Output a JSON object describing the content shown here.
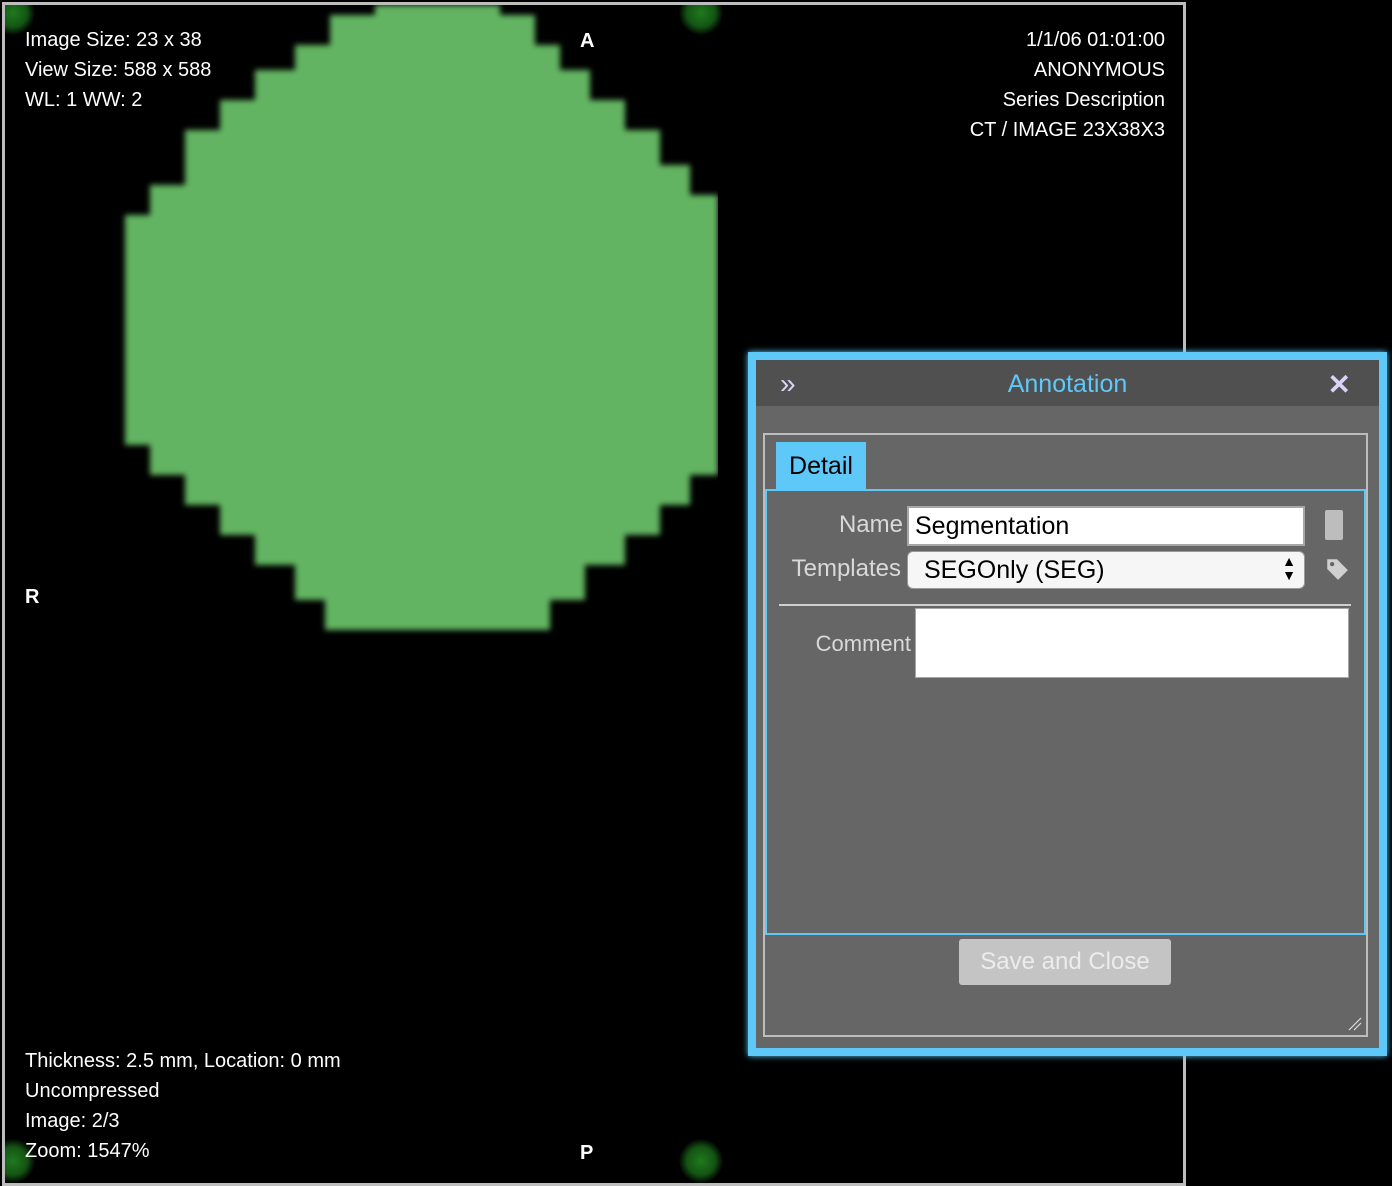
{
  "viewer": {
    "top_left": [
      "Image Size: 23 x 38",
      "View Size: 588 x 588",
      "WL: 1 WW: 2"
    ],
    "top_right": [
      "1/1/06 01:01:00",
      "ANONYMOUS",
      "Series Description",
      "CT / IMAGE 23X38X3"
    ],
    "bottom_left": [
      "Thickness: 2.5 mm, Location: 0 mm",
      "Uncompressed",
      "Image: 2/3",
      "Zoom: 1547%"
    ],
    "orientation": {
      "top": "A",
      "left": "R",
      "bottom": "P"
    },
    "segment_color": "#62b462"
  },
  "annotation_dialog": {
    "title": "Annotation",
    "collapse_icon": "double-chevron-right-icon",
    "close_icon": "close-icon",
    "tab": "Detail",
    "name_label": "Name",
    "name_value": "Segmentation",
    "templates_label": "Templates",
    "templates_selected": "SEGOnly (SEG)",
    "tag_icon": "tag-icon",
    "comment_label": "Comment",
    "comment_value": "",
    "save_button": "Save and Close",
    "accent_color": "#5ec8f8"
  }
}
